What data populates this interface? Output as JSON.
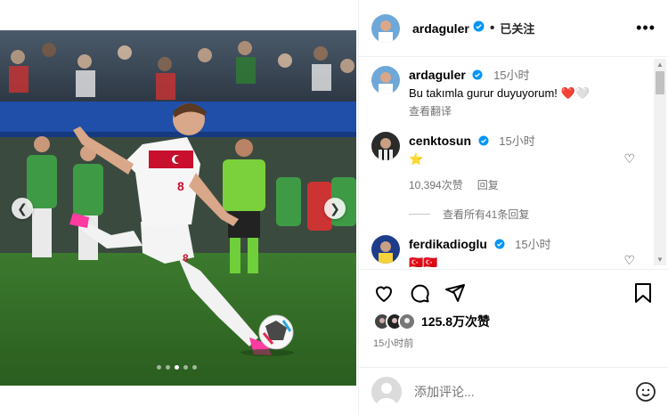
{
  "header": {
    "username": "ardaguler",
    "follow_status": "已关注",
    "more": "•••"
  },
  "comments": [
    {
      "username": "ardaguler",
      "time": "15小时",
      "text": "Bu takımla gurur duyuyorum! ❤️🤍",
      "translate": "查看翻译"
    },
    {
      "username": "cenktosun",
      "time": "15小时",
      "text": "⭐",
      "likes": "10,394次赞",
      "reply": "回复",
      "view_replies": "查看所有41条回复"
    },
    {
      "username": "ferdikadioglu",
      "time": "15小时",
      "text": "🇹🇷🇹🇷"
    }
  ],
  "post": {
    "likes": "125.8万次赞",
    "time": "15小时前",
    "carousel": {
      "slides": 5,
      "active": 3
    }
  },
  "add_comment": {
    "placeholder": "添加评论..."
  },
  "colors": {
    "accent_blue": "#0095f6",
    "heart_red": "#ed2a3d",
    "border": "#efefef",
    "muted": "#737373"
  }
}
